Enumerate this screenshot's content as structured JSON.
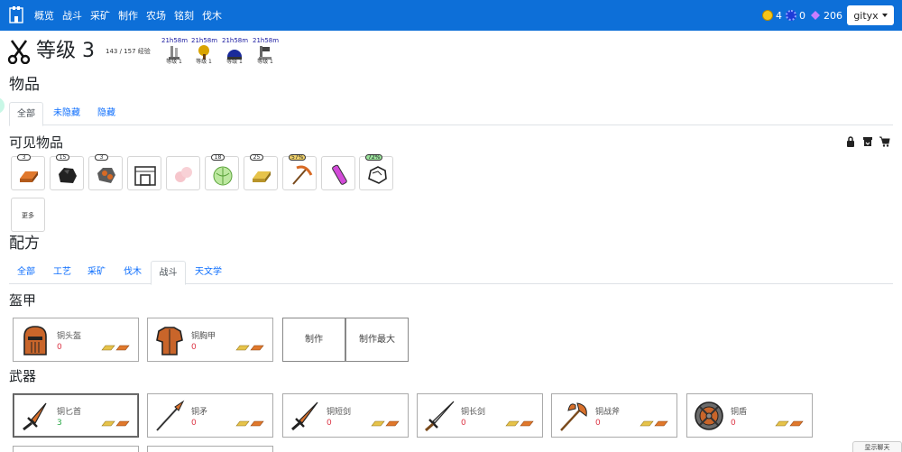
{
  "nav": {
    "links": [
      "概览",
      "战斗",
      "采矿",
      "制作",
      "农场",
      "铭刻",
      "伐木"
    ],
    "gold": "4",
    "gems": "0",
    "crystals": "206",
    "user": "gityx"
  },
  "skill": {
    "title": "等级 3",
    "xp": "143 / 157 经验",
    "buffs": [
      {
        "timer": "21h58m",
        "level": "等级 1",
        "icon": "mining-tool-icon"
      },
      {
        "timer": "21h58m",
        "level": "等级 1",
        "icon": "tree-icon"
      },
      {
        "timer": "21h58m",
        "level": "等级 1",
        "icon": "observatory-icon"
      },
      {
        "timer": "21h58m",
        "level": "等级 1",
        "icon": "hammer-icon"
      }
    ]
  },
  "items": {
    "heading": "物品",
    "tabs": [
      "全部",
      "未隐藏",
      "隐藏"
    ],
    "visible_heading": "可见物品",
    "tiles": [
      {
        "badge": "3",
        "icon": "copper-bar-icon"
      },
      {
        "badge": "15",
        "icon": "coal-icon"
      },
      {
        "badge": "3",
        "icon": "copper-ore-icon"
      },
      {
        "badge": "",
        "icon": "furnace-icon"
      },
      {
        "badge": "",
        "icon": "cotton-icon"
      },
      {
        "badge": "18",
        "icon": "cabbage-icon"
      },
      {
        "badge": "25",
        "icon": "gold-bar-icon"
      },
      {
        "badge": "57%",
        "icon": "copper-pickaxe-icon"
      },
      {
        "badge": "",
        "icon": "potion-tube-icon"
      },
      {
        "badge": "72%",
        "icon": "stone-icon"
      }
    ],
    "more": "更多"
  },
  "recipes": {
    "heading": "配方",
    "tabs": [
      "全部",
      "工艺",
      "采矿",
      "伐木",
      "战斗",
      "天文学"
    ],
    "armor_heading": "盔甲",
    "armor": [
      {
        "name": "铜头盔",
        "count": "0"
      },
      {
        "name": "铜胸甲",
        "count": "0"
      }
    ],
    "craft_label": "制作",
    "craft_max_label": "制作最大",
    "weapons_heading": "武器",
    "weapons": [
      {
        "name": "铜匕首",
        "count": "3"
      },
      {
        "name": "铜矛",
        "count": "0"
      },
      {
        "name": "铜短剑",
        "count": "0"
      },
      {
        "name": "铜长剑",
        "count": "0"
      },
      {
        "name": "铜战斧",
        "count": "0"
      },
      {
        "name": "铜盾",
        "count": "0"
      }
    ]
  },
  "chat_label": "显示聊天",
  "colors": {
    "navbar": "#0d6fd8",
    "link": "#0d6efd",
    "danger": "#dc3545",
    "success": "#28a745"
  }
}
